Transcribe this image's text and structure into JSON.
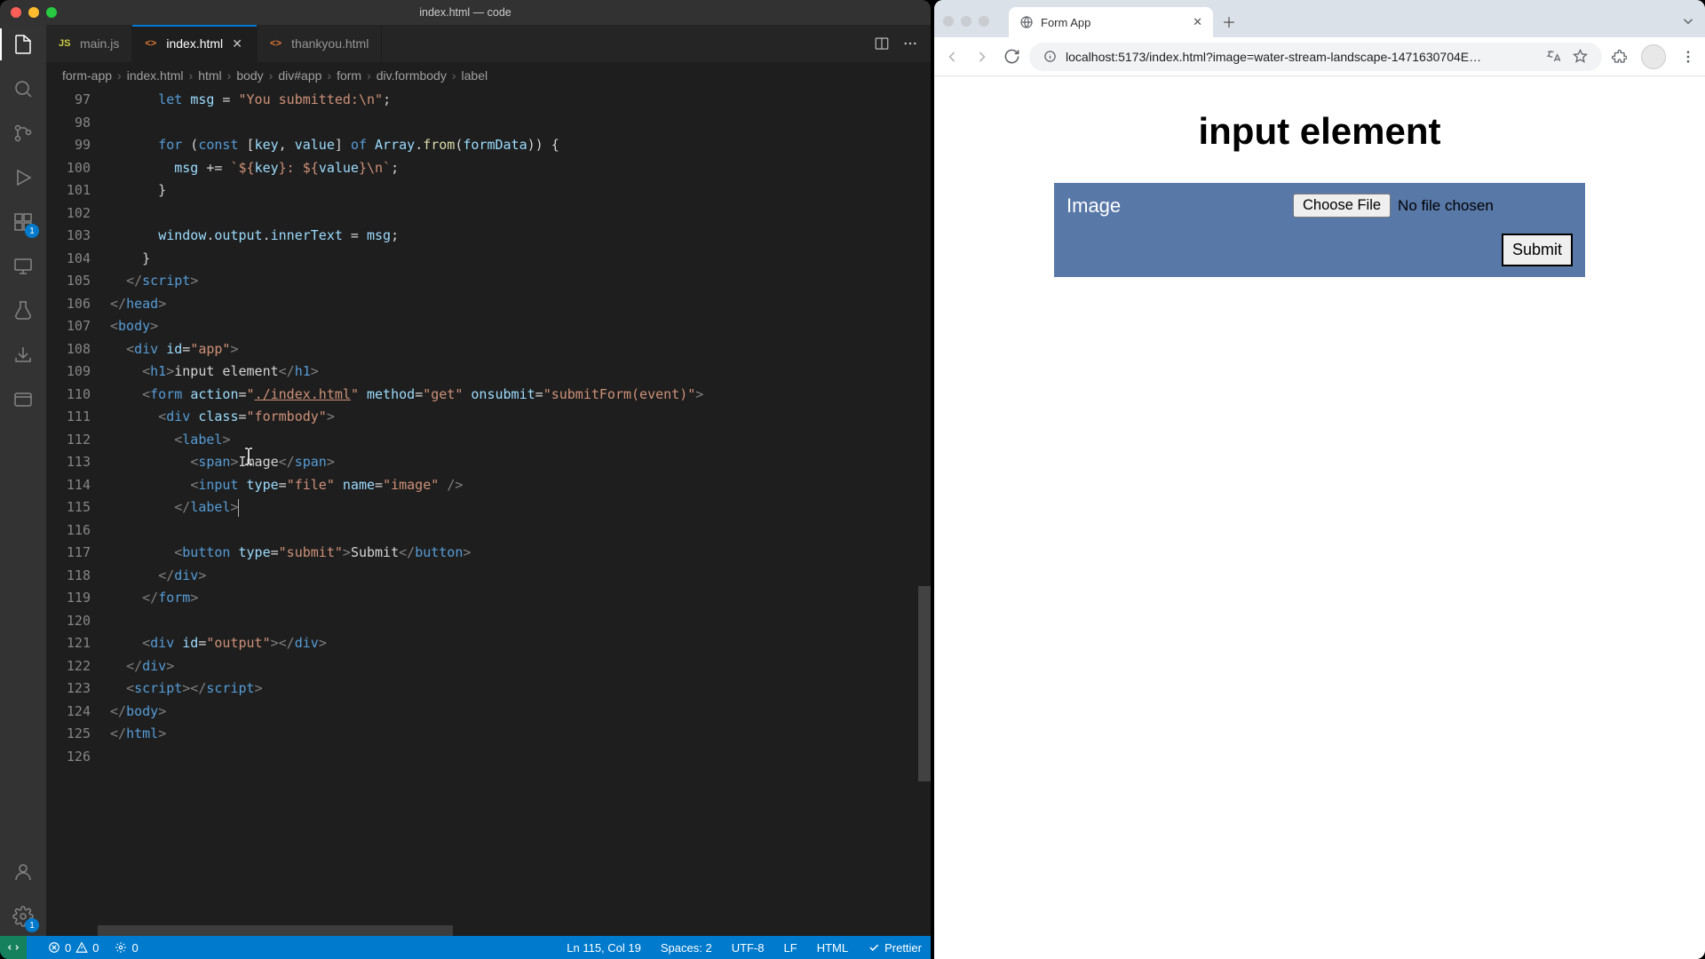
{
  "vscode": {
    "window_title": "index.html — code",
    "tabs": [
      {
        "icon": "js",
        "label": "main.js",
        "active": false,
        "dirty": false
      },
      {
        "icon": "html",
        "label": "index.html",
        "active": true,
        "dirty": false
      },
      {
        "icon": "html",
        "label": "thankyou.html",
        "active": false,
        "dirty": false
      }
    ],
    "breadcrumb": [
      "form-app",
      "index.html",
      "html",
      "body",
      "div#app",
      "form",
      "div.formbody",
      "label"
    ],
    "activity_badges": {
      "extensions": "1",
      "settings": "1"
    },
    "code": {
      "first_line": 97,
      "lines": [
        {
          "n": 97,
          "html": "      <span class='tk-kw'>let</span> <span class='tk-var'>msg</span> = <span class='tk-str'>\"You submitted:\\n\"</span>;"
        },
        {
          "n": 98,
          "html": ""
        },
        {
          "n": 99,
          "html": "      <span class='tk-kw'>for</span> (<span class='tk-kw'>const</span> [<span class='tk-var'>key</span>, <span class='tk-var'>value</span>] <span class='tk-kw'>of</span> <span class='tk-var'>Array</span>.<span class='tk-fn'>from</span>(<span class='tk-var'>formData</span>)) {"
        },
        {
          "n": 100,
          "html": "        <span class='tk-var'>msg</span> += <span class='tk-str'>`${<span class='tk-var'>key</span>}: ${<span class='tk-var'>value</span>}\\n`</span>;"
        },
        {
          "n": 101,
          "html": "      }"
        },
        {
          "n": 102,
          "html": ""
        },
        {
          "n": 103,
          "html": "      <span class='tk-var'>window</span>.<span class='tk-var'>output</span>.<span class='tk-var'>innerText</span> = <span class='tk-var'>msg</span>;"
        },
        {
          "n": 104,
          "html": "    }"
        },
        {
          "n": 105,
          "html": "  <span class='tk-punc'>&lt;/</span><span class='tk-tag'>script</span><span class='tk-punc'>&gt;</span>"
        },
        {
          "n": 106,
          "html": "<span class='tk-punc'>&lt;/</span><span class='tk-tag'>head</span><span class='tk-punc'>&gt;</span>"
        },
        {
          "n": 107,
          "html": "<span class='tk-punc'>&lt;</span><span class='tk-tag'>body</span><span class='tk-punc'>&gt;</span>"
        },
        {
          "n": 108,
          "html": "  <span class='tk-punc'>&lt;</span><span class='tk-tag'>div</span> <span class='tk-attr'>id</span>=<span class='tk-str'>\"app\"</span><span class='tk-punc'>&gt;</span>"
        },
        {
          "n": 109,
          "html": "    <span class='tk-punc'>&lt;</span><span class='tk-tag'>h1</span><span class='tk-punc'>&gt;</span>input element<span class='tk-punc'>&lt;/</span><span class='tk-tag'>h1</span><span class='tk-punc'>&gt;</span>"
        },
        {
          "n": 110,
          "html": "    <span class='tk-punc'>&lt;</span><span class='tk-tag'>form</span> <span class='tk-attr'>action</span>=<span class='tk-str'>\"<u>./index.html</u>\"</span> <span class='tk-attr'>method</span>=<span class='tk-str'>\"get\"</span> <span class='tk-attr'>onsubmit</span>=<span class='tk-str'>\"submitForm(event)\"</span><span class='tk-punc'>&gt;</span>"
        },
        {
          "n": 111,
          "html": "      <span class='tk-punc'>&lt;</span><span class='tk-tag'>div</span> <span class='tk-attr'>class</span>=<span class='tk-str'>\"formbody\"</span><span class='tk-punc'>&gt;</span>"
        },
        {
          "n": 112,
          "html": "        <span class='tk-punc'>&lt;</span><span class='tk-tag'>label</span><span class='tk-punc'>&gt;</span>"
        },
        {
          "n": 113,
          "html": "          <span class='tk-punc'>&lt;</span><span class='tk-tag'>span</span><span class='tk-punc'>&gt;</span>Image<span class='tk-punc'>&lt;/</span><span class='tk-tag'>span</span><span class='tk-punc'>&gt;</span>"
        },
        {
          "n": 114,
          "html": "          <span class='tk-punc'>&lt;</span><span class='tk-tag'>input</span> <span class='tk-attr'>type</span>=<span class='tk-str'>\"file\"</span> <span class='tk-attr'>name</span>=<span class='tk-str'>\"image\"</span> <span class='tk-punc'>/&gt;</span>"
        },
        {
          "n": 115,
          "html": "        <span class='tk-punc'>&lt;/</span><span class='tk-tag'>label</span><span class='tk-punc'>&gt;</span><span class='cursor'></span>"
        },
        {
          "n": 116,
          "html": ""
        },
        {
          "n": 117,
          "html": "        <span class='tk-punc'>&lt;</span><span class='tk-tag'>button</span> <span class='tk-attr'>type</span>=<span class='tk-str'>\"submit\"</span><span class='tk-punc'>&gt;</span>Submit<span class='tk-punc'>&lt;/</span><span class='tk-tag'>button</span><span class='tk-punc'>&gt;</span>"
        },
        {
          "n": 118,
          "html": "      <span class='tk-punc'>&lt;/</span><span class='tk-tag'>div</span><span class='tk-punc'>&gt;</span>"
        },
        {
          "n": 119,
          "html": "    <span class='tk-punc'>&lt;/</span><span class='tk-tag'>form</span><span class='tk-punc'>&gt;</span>"
        },
        {
          "n": 120,
          "html": ""
        },
        {
          "n": 121,
          "html": "    <span class='tk-punc'>&lt;</span><span class='tk-tag'>div</span> <span class='tk-attr'>id</span>=<span class='tk-str'>\"output\"</span><span class='tk-punc'>&gt;&lt;/</span><span class='tk-tag'>div</span><span class='tk-punc'>&gt;</span>"
        },
        {
          "n": 122,
          "html": "  <span class='tk-punc'>&lt;/</span><span class='tk-tag'>div</span><span class='tk-punc'>&gt;</span>"
        },
        {
          "n": 123,
          "html": "  <span class='tk-punc'>&lt;</span><span class='tk-tag'>script</span><span class='tk-punc'>&gt;&lt;/</span><span class='tk-tag'>script</span><span class='tk-punc'>&gt;</span>"
        },
        {
          "n": 124,
          "html": "<span class='tk-punc'>&lt;/</span><span class='tk-tag'>body</span><span class='tk-punc'>&gt;</span>"
        },
        {
          "n": 125,
          "html": "<span class='tk-punc'>&lt;/</span><span class='tk-tag'>html</span><span class='tk-punc'>&gt;</span>"
        },
        {
          "n": 126,
          "html": ""
        }
      ]
    },
    "status": {
      "errors": "0",
      "warnings": "0",
      "ports": "0",
      "cursor": "Ln 115, Col 19",
      "spaces": "Spaces: 2",
      "encoding": "UTF-8",
      "eol": "LF",
      "lang": "HTML",
      "formatter": "Prettier"
    }
  },
  "browser": {
    "tab_title": "Form App",
    "url": "localhost:5173/index.html?image=water-stream-landscape-1471630704E…",
    "page": {
      "heading": "input element",
      "label": "Image",
      "choose_button": "Choose File",
      "no_file": "No file chosen",
      "submit": "Submit"
    }
  }
}
